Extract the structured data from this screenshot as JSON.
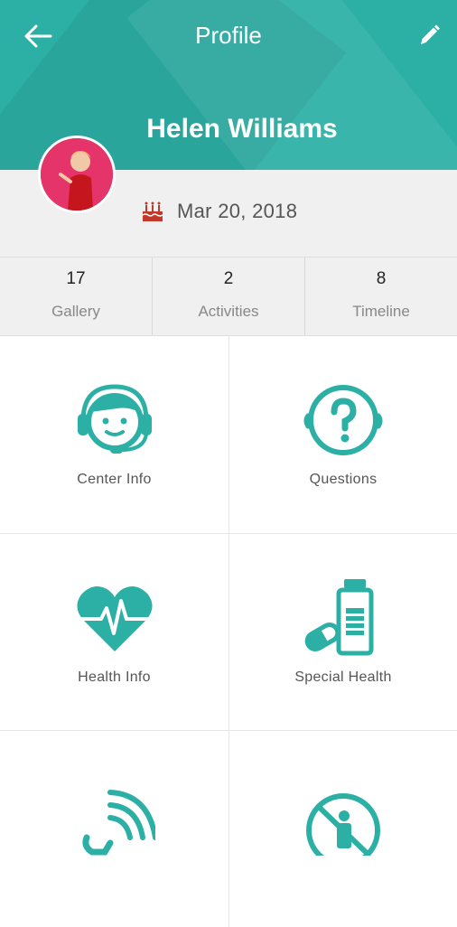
{
  "header": {
    "title": "Profile"
  },
  "profile": {
    "name": "Helen Williams",
    "birth_date": "Mar 20, 2018"
  },
  "stats": [
    {
      "count": "17",
      "label": "Gallery"
    },
    {
      "count": "2",
      "label": "Activities"
    },
    {
      "count": "8",
      "label": "Timeline"
    }
  ],
  "menu": [
    {
      "label": "Center Info",
      "icon": "headset-icon"
    },
    {
      "label": "Questions",
      "icon": "question-head-icon"
    },
    {
      "label": "Health Info",
      "icon": "heartbeat-icon"
    },
    {
      "label": "Special Health",
      "icon": "medicine-bottle-icon"
    },
    {
      "label": "",
      "icon": "phone-call-icon"
    },
    {
      "label": "",
      "icon": "no-person-icon"
    }
  ],
  "colors": {
    "accent": "#2cb0a6",
    "avatar_bg": "#e5346a",
    "cake": "#c0392b"
  }
}
